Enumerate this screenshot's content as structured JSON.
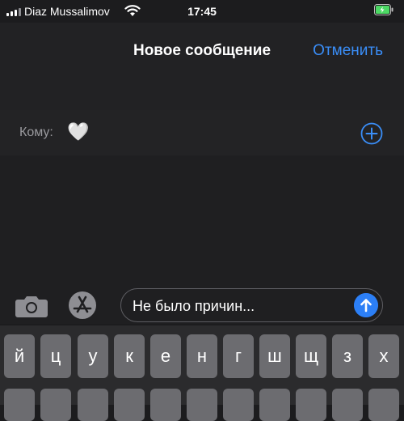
{
  "status_bar": {
    "carrier": "Diaz Mussalimov",
    "time": "17:45"
  },
  "nav": {
    "title": "Новое сообщение",
    "cancel_label": "Отменить"
  },
  "recipient": {
    "label": "Кому:",
    "value": "🤍"
  },
  "composer": {
    "text": "Не было причин..."
  },
  "keyboard": {
    "row1": [
      "й",
      "ц",
      "у",
      "к",
      "е",
      "н",
      "г",
      "ш",
      "щ",
      "з",
      "х"
    ]
  },
  "colors": {
    "accent": "#3a8ef8",
    "send": "#2c7ff6",
    "background": "#1c1c1e",
    "key": "#6c6c70",
    "battery": "#4cd964"
  }
}
